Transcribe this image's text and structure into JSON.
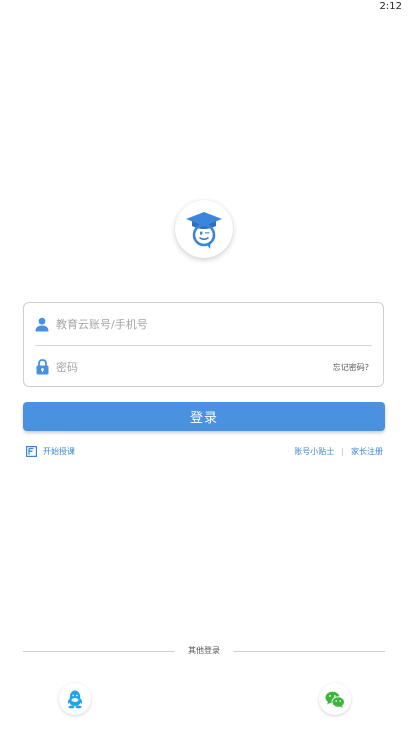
{
  "status_bar": {
    "time": "2:12"
  },
  "login": {
    "username_placeholder": "教育云账号/手机号",
    "password_placeholder": "密码",
    "forgot_password": "忘记密码?",
    "login_button": "登录"
  },
  "links": {
    "start_class": "开始授课",
    "account_tips": "账号小贴士",
    "separator": "|",
    "parent_register": "家长注册"
  },
  "other_login": {
    "label": "其他登录",
    "providers": [
      {
        "icon": "qq-icon",
        "color": "#1fa2e6"
      },
      {
        "icon": "wechat-icon",
        "color": "#3bb53b"
      }
    ]
  },
  "colors": {
    "accent": "#4a92e0",
    "link": "#3a86d8",
    "logo_blue": "#3c86da"
  }
}
